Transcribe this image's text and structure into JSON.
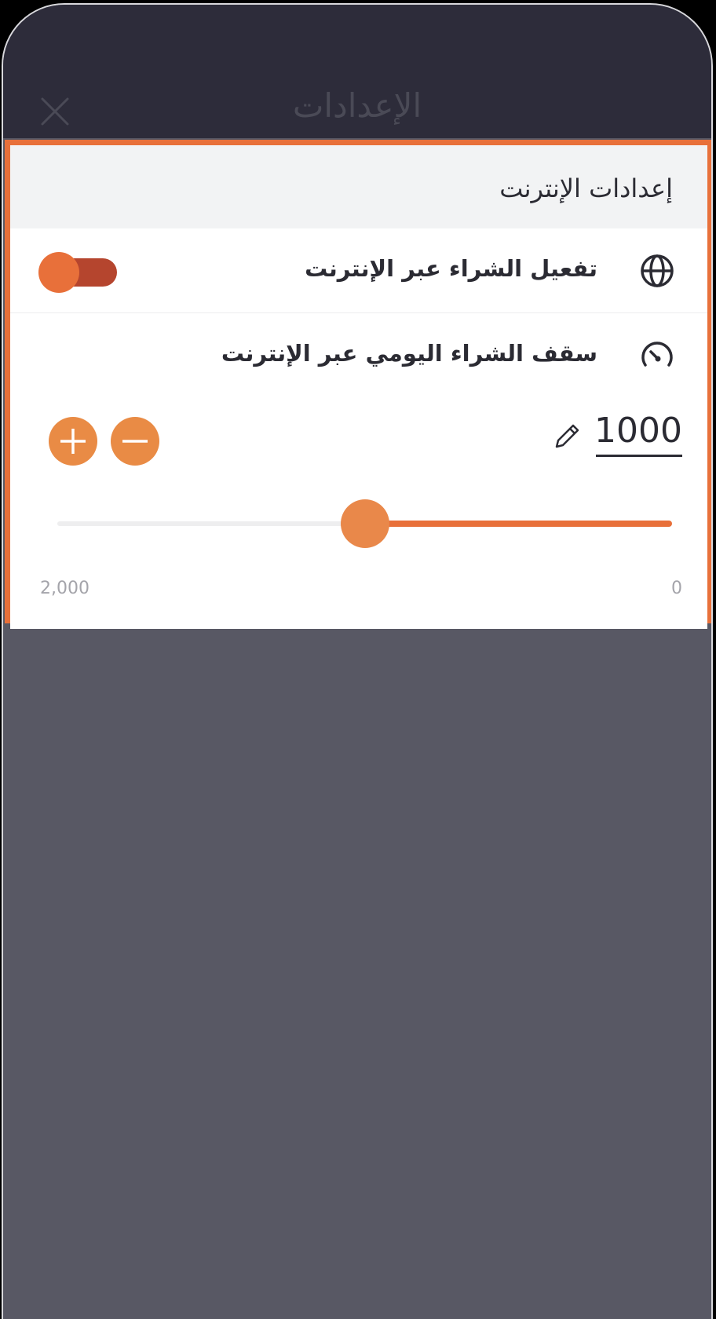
{
  "header": {
    "title": "الإعدادات",
    "close_icon": "close-icon"
  },
  "section": {
    "title": "إعدادات الإنترنت"
  },
  "online_purchase": {
    "label": "تفعيل الشراء عبر الإنترنت",
    "icon": "globe-icon",
    "enabled": true
  },
  "daily_limit": {
    "label": "سقف الشراء اليومي عبر الإنترنت",
    "icon": "speedometer-icon",
    "value": "1000",
    "edit_icon": "pencil-icon",
    "increase_icon": "plus-icon",
    "decrease_icon": "minus-icon",
    "slider_min_label": "0",
    "slider_max_label": "2,000",
    "slider_min": 0,
    "slider_max": 2000,
    "slider_value": 1000
  },
  "colors": {
    "accent": "#e8703a",
    "button": "#e98b45",
    "toggle_track": "#b5452e",
    "header_bg": "#2d2c3a",
    "overlay_bg": "#585864"
  }
}
